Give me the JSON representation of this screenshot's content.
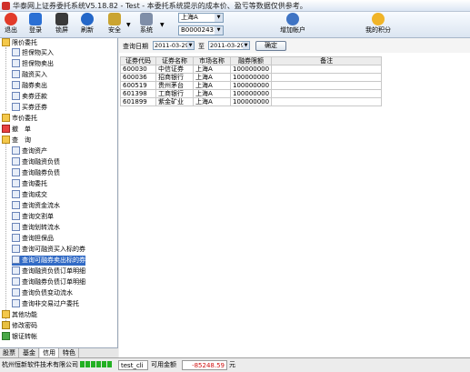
{
  "window": {
    "title": "华泰网上证券委托系统V5.18.82 - Test - 本委托系统提示的成本价、盈亏等数据仅供参考。"
  },
  "toolbar": {
    "exit": "退出",
    "login": "登录",
    "lock": "锁屏",
    "refresh": "刷新",
    "security": "安全",
    "system": "系统",
    "market": "上海A",
    "account": "B000024313",
    "add_account": "增加帐户",
    "my_points": "我的积分"
  },
  "sidebar": {
    "limit_order": "限价委托",
    "guarantee_in": "担保物买入",
    "guarantee_out": "担保物卖出",
    "margin_buy": "融资买入",
    "short_sell": "融券卖出",
    "sell_repay": "卖券还款",
    "buy_repay": "买券还券",
    "market_order": "市价委托",
    "cancel": "撤　单",
    "query": "查　询",
    "q_assets": "查询资产",
    "q_margin_debt": "查询融资负债",
    "q_short_debt": "查询融券负债",
    "q_orders": "查询委托",
    "q_deals": "查询成交",
    "q_funds_flow": "查询资金流水",
    "q_statement": "查询交割单",
    "q_transfer_flow": "查询划转流水",
    "q_collateral": "查询担保品",
    "q_margin_targets": "查询可融资买入标的券",
    "q_short_targets": "查询可融券卖出标的券",
    "q_margin_contracts": "查询融资负债订单明细",
    "q_short_contracts": "查询融券负债订单明细",
    "q_debt_change": "查询负债变动流水",
    "q_nontrade": "查询非交易过户委托",
    "other": "其他功能",
    "change_pwd": "修改密码",
    "bank_transfer": "银证转帐",
    "tabs": [
      "股票",
      "基金",
      "信用",
      "特色"
    ]
  },
  "query": {
    "date_label": "查询日期",
    "start": "2011-03-29",
    "to": "至",
    "end": "2011-03-29",
    "confirm": "确定",
    "columns": [
      "证券代码",
      "证券名称",
      "市场名称",
      "融券限额",
      "备注"
    ],
    "rows": [
      [
        "600030",
        "中信证券",
        "上海A",
        "100000000",
        ""
      ],
      [
        "600036",
        "招商银行",
        "上海A",
        "100000000",
        ""
      ],
      [
        "600519",
        "贵州茅台",
        "上海A",
        "100000000",
        ""
      ],
      [
        "601398",
        "工商银行",
        "上海A",
        "100000000",
        ""
      ],
      [
        "601899",
        "紫金矿业",
        "上海A",
        "100000000",
        ""
      ]
    ]
  },
  "statusbar": {
    "company": "杭州恒新软件技术有限公司",
    "user": "test_cli",
    "avail_label": "可用金额",
    "avail_value": "-85248.59",
    "unit": "元"
  }
}
